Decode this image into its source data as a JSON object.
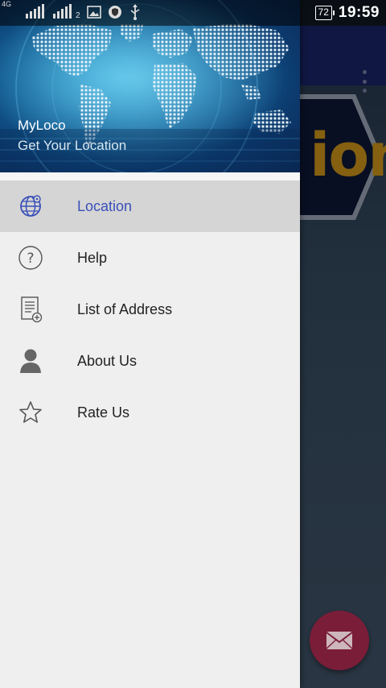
{
  "status_bar": {
    "network_label": "4G",
    "sim2_label": "2",
    "battery_level": "72",
    "time": "19:59",
    "icons": [
      "signal-icon",
      "signal-2-icon",
      "image-icon",
      "shield-icon",
      "usb-icon",
      "battery-icon"
    ]
  },
  "background_app": {
    "banner_text": "ion",
    "fab_icon": "mail-icon"
  },
  "drawer": {
    "header": {
      "app_name": "MyLoco",
      "subtitle": "Get Your Location"
    },
    "items": [
      {
        "label": "Location",
        "icon": "globe-icon",
        "active": true
      },
      {
        "label": "Help",
        "icon": "help-icon",
        "active": false
      },
      {
        "label": "List of Address",
        "icon": "address-list-icon",
        "active": false
      },
      {
        "label": "About Us",
        "icon": "person-icon",
        "active": false
      },
      {
        "label": "Rate Us",
        "icon": "star-icon",
        "active": false
      }
    ]
  },
  "colors": {
    "accent": "#3a4fb8",
    "toolbar": "#1e2a78",
    "fab": "#7a1d38",
    "drawer_bg": "#efefef",
    "active_item_bg": "#d5d5d5"
  }
}
